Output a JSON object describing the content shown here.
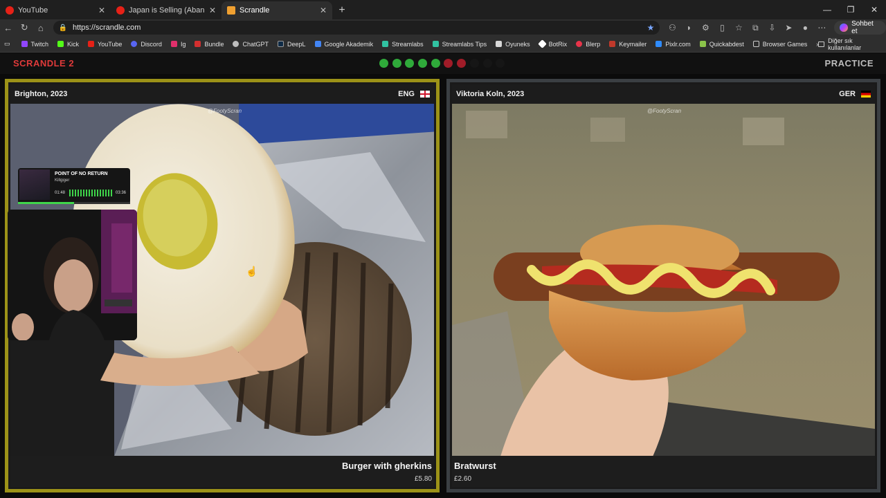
{
  "browser": {
    "tabs": [
      {
        "title": "YouTube",
        "favicon_color": "#e62117",
        "active": false
      },
      {
        "title": "Japan is Selling (Abandoned) Hou",
        "favicon_color": "#e62117",
        "active": false
      },
      {
        "title": "Scrandle",
        "favicon_color": "#f0a030",
        "active": true
      }
    ],
    "new_tab": "+",
    "window_controls": [
      "—",
      "❐",
      "✕"
    ],
    "url": "https://scrandle.com",
    "chat_button": "Sohbet et",
    "bookmarks": [
      {
        "label": "Twitch",
        "color": "#9146ff"
      },
      {
        "label": "Kick",
        "color": "#53fc18"
      },
      {
        "label": "YouTube",
        "color": "#e62117"
      },
      {
        "label": "Discord",
        "color": "#5865f2"
      },
      {
        "label": "Ig",
        "color": "#e1306c"
      },
      {
        "label": "Bundle",
        "color": "#d32f2f"
      },
      {
        "label": "ChatGPT",
        "color": "#bdbdbd"
      },
      {
        "label": "DeepL",
        "color": "#0f2b46"
      },
      {
        "label": "Google Akademik",
        "color": "#4285f4"
      },
      {
        "label": "Streamlabs",
        "color": "#31c3a2"
      },
      {
        "label": "Streamlabs Tips",
        "color": "#31c3a2"
      },
      {
        "label": "Oyuneks",
        "color": "#d8d8d8"
      },
      {
        "label": "BotRix",
        "color": "#ffffff"
      },
      {
        "label": "Blerp",
        "color": "#e8344a"
      },
      {
        "label": "Keymailer",
        "color": "#c0392b"
      },
      {
        "label": "Pixlr.com",
        "color": "#2f8cff"
      },
      {
        "label": "Quickabdest",
        "color": "#8bc34a"
      },
      {
        "label": "Browser Games",
        "color": "#cccccc"
      }
    ],
    "bookmarks_overflow": "Diğer sık kullanılanlar"
  },
  "app": {
    "logo": "SCRANDLE 2",
    "mode": "PRACTICE",
    "progress": [
      "#2faa3a",
      "#2faa3a",
      "#2faa3a",
      "#2faa3a",
      "#2faa3a",
      "#a01c28",
      "#a01c28",
      "#161616",
      "#161616",
      "#161616"
    ]
  },
  "cards": {
    "left": {
      "origin": "Brighton, 2023",
      "country": "ENG",
      "watermark": "@FootyScran",
      "dish": "Burger with gherkins",
      "price": "£5.80"
    },
    "right": {
      "origin": "Viktoria Koln, 2023",
      "country": "GER",
      "watermark": "@FootyScran",
      "dish": "Bratwurst",
      "price": "£2.60"
    }
  },
  "now_playing": {
    "song": "POINT OF NO RETURN",
    "artist": "Killgiger",
    "elapsed": "01:48",
    "duration": "03:36",
    "progress_fraction": 0.5
  }
}
